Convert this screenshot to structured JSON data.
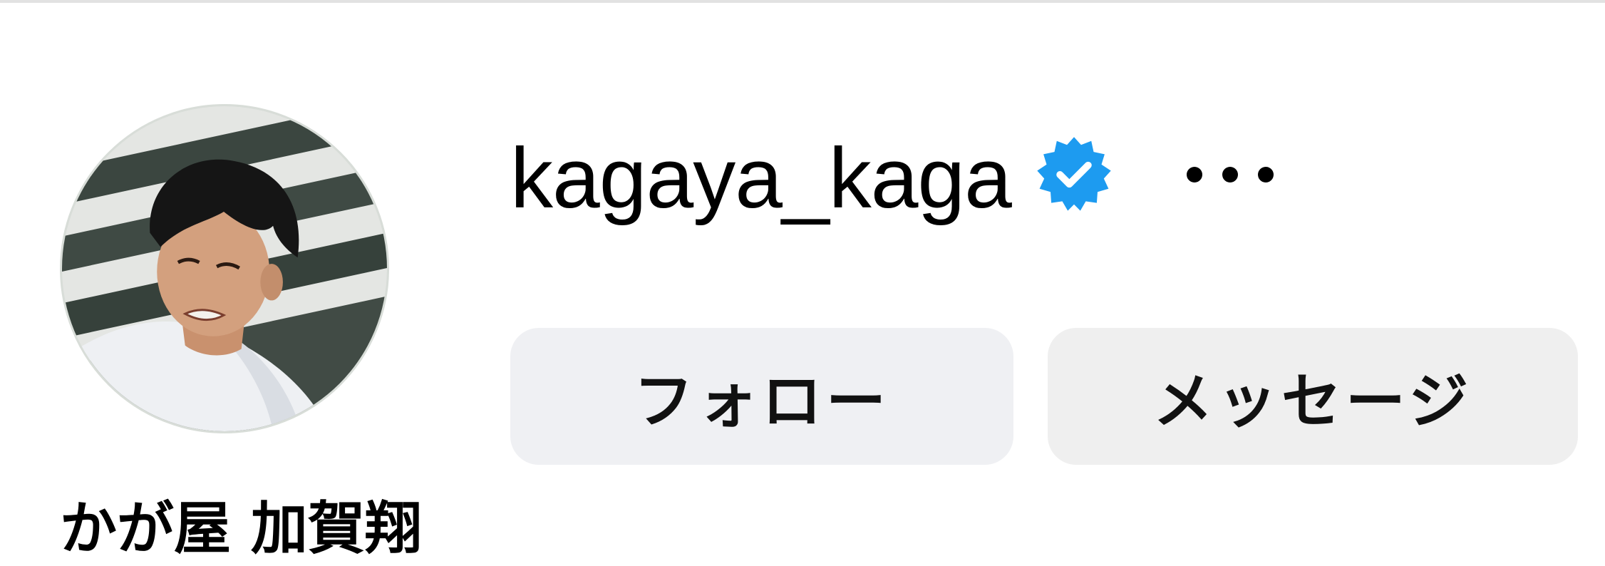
{
  "profile": {
    "username": "kagaya_kaga",
    "display_name": "かが屋 加賀翔",
    "verified": true,
    "avatar_icon": "profile-photo"
  },
  "actions": {
    "follow_label": "フォロー",
    "message_label": "メッセージ",
    "more_icon": "more-horizontal-icon"
  },
  "colors": {
    "verified_badge": "#1d9bf0",
    "button_bg": "#eff0f3",
    "text": "#000000"
  }
}
